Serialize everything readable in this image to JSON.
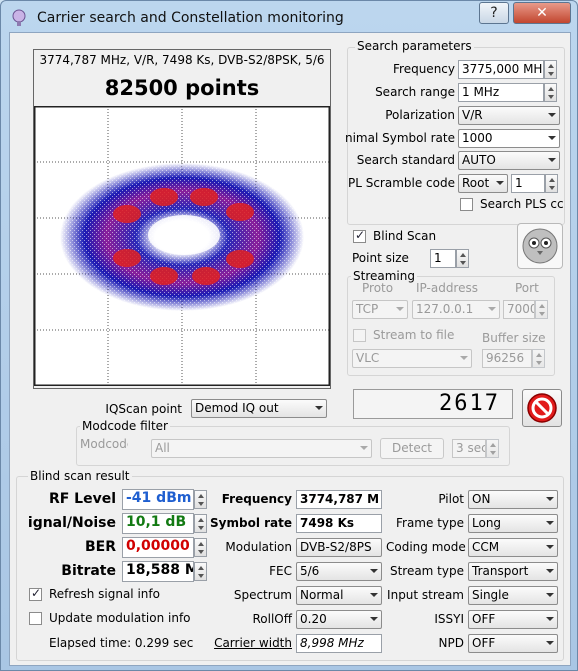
{
  "window": {
    "title": "Carrier search and Constellation monitoring",
    "help_label": "?",
    "close_label": "✕"
  },
  "plot": {
    "header": "3774,787 MHz, V/R, 7498 Ks, DVB-S2/8PSK, 5/6",
    "points": "82500 points"
  },
  "search": {
    "group_title": "Search parameters",
    "frequency_label": "Frequency",
    "frequency_value": "3775,000 MHz",
    "range_label": "Search range",
    "range_value": "1 MHz",
    "polarization_label": "Polarization",
    "polarization_value": "V/R",
    "minsr_label": "nimal Symbol rate",
    "minsr_value": "1000",
    "standard_label": "Search standard",
    "standard_value": "AUTO",
    "plscramble_label": "PL Scramble code",
    "plscramble_mode": "Root",
    "plscramble_value": "1",
    "searchpls_label": "Search PLS cc"
  },
  "blind": {
    "label": "Blind Scan",
    "pointsize_label": "Point size",
    "pointsize_value": "1"
  },
  "streaming": {
    "group_title": "Streaming",
    "proto_label": "Proto",
    "ip_label": "IP-address",
    "port_label": "Port",
    "proto_value": "TCP",
    "ip_value": "127.0.0.1",
    "port_value": "7000",
    "stream_to_file_label": "Stream to file",
    "buffer_label": "Buffer size",
    "player_value": "VLC",
    "buffer_value": "96256"
  },
  "counter": "2617",
  "iqscan": {
    "label": "IQScan point",
    "value": "Demod IQ out"
  },
  "modcode": {
    "group_title": "Modcode filter",
    "label": "Modcode",
    "value": "All",
    "detect_label": "Detect",
    "time_value": "3 sec"
  },
  "result": {
    "group_title": "Blind scan result",
    "rf_label": "RF Level",
    "rf_value": "-41 dBm",
    "snr_label": "ignal/Noise",
    "snr_value": "10,1 dB",
    "ber_label": "BER",
    "ber_value": "0,00000",
    "bitrate_label": "Bitrate",
    "bitrate_value": "18,588 M",
    "freq_label": "Frequency",
    "freq_value": "3774,787 M",
    "sr_label": "Symbol rate",
    "sr_value": "7498 Ks",
    "modulation_label": "Modulation",
    "modulation_value": "DVB-S2/8PS",
    "fec_label": "FEC",
    "fec_value": "5/6",
    "spectrum_label": "Spectrum",
    "spectrum_value": "Normal",
    "rolloff_label": "RollOff",
    "rolloff_value": "0.20",
    "carrierwidth_label": "Carrier width",
    "carrierwidth_value": "8,998 MHz",
    "pilot_label": "Pilot",
    "pilot_value": "ON",
    "frametype_label": "Frame type",
    "frametype_value": "Long",
    "codingmode_label": "Coding mode",
    "codingmode_value": "CCM",
    "streamtype_label": "Stream type",
    "streamtype_value": "Transport",
    "inputstream_label": "Input stream",
    "inputstream_value": "Single",
    "issyi_label": "ISSYI",
    "issyi_value": "OFF",
    "npd_label": "NPD",
    "npd_value": "OFF",
    "refresh_label": "Refresh signal info",
    "update_label": "Update modulation info",
    "elapsed_label": "Elapsed time: 0.299 sec"
  },
  "colors": {
    "rf": "#1f5fd0",
    "snr": "#137a13",
    "ber": "#d10000",
    "constellation_outer": "#1010b0",
    "constellation_core": "#e02020"
  }
}
